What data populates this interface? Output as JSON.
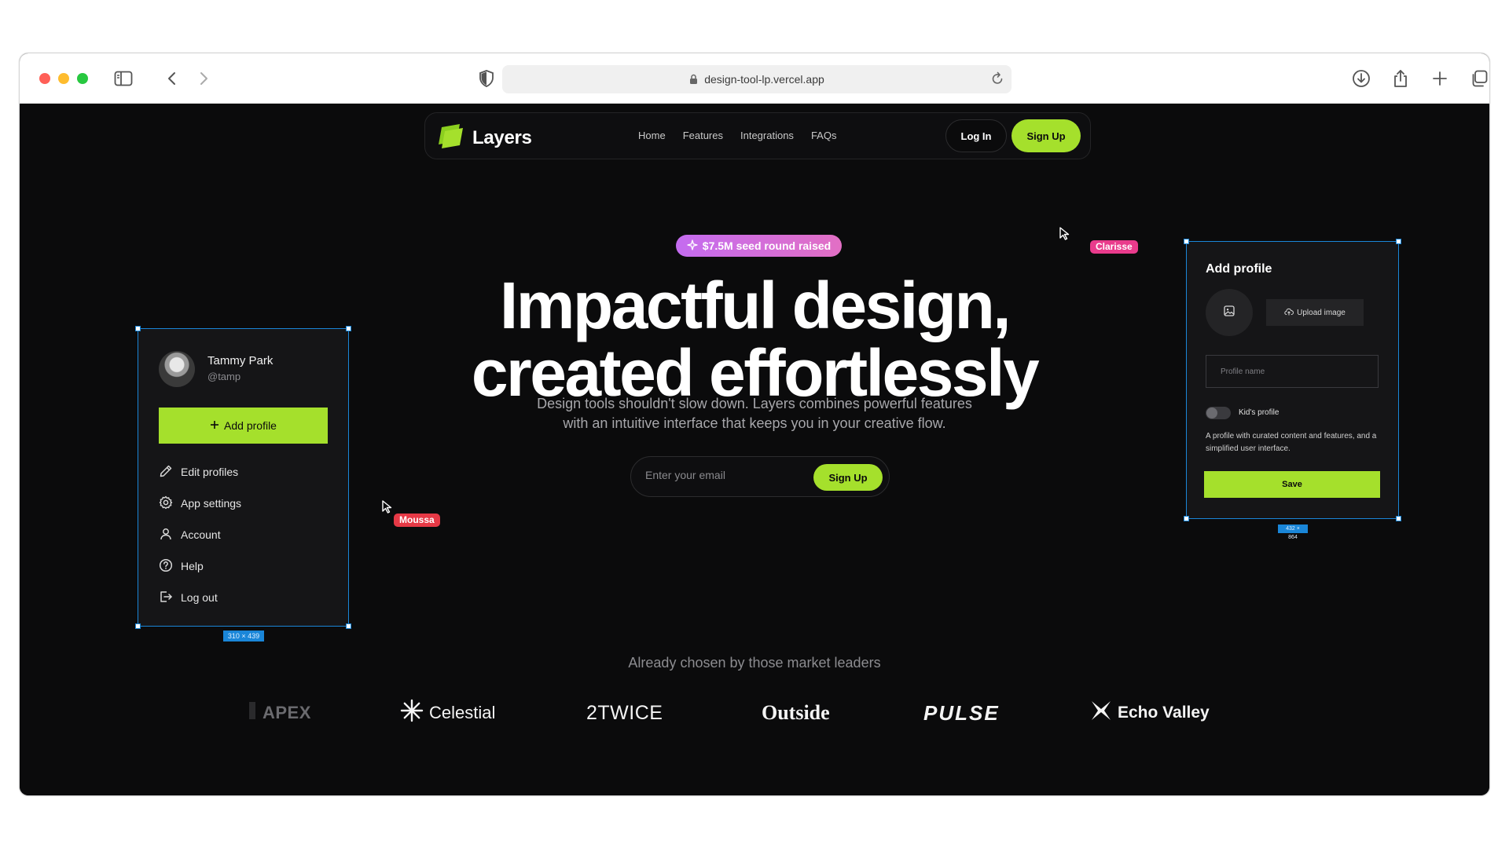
{
  "browser": {
    "url": "design-tool-lp.vercel.app"
  },
  "nav": {
    "logo_text": "Layers",
    "links": [
      "Home",
      "Features",
      "Integrations",
      "FAQs"
    ],
    "login_label": "Log In",
    "signup_label": "Sign Up"
  },
  "hero": {
    "badge": "$7.5M seed round raised",
    "headline_line1": "Impactful design,",
    "headline_line2": "created effortlessly",
    "subtitle_line1": "Design tools shouldn't slow down. Layers combines powerful features",
    "subtitle_line2": "with an intuitive interface that keeps you in your creative flow.",
    "email_placeholder": "Enter your email",
    "signup_label": "Sign Up"
  },
  "profile_menu_card": {
    "user_name": "Tammy Park",
    "user_handle": "@tamp",
    "add_profile_label": "Add profile",
    "menu_items": [
      {
        "label": "Edit profiles",
        "icon": "pencil-icon"
      },
      {
        "label": "App settings",
        "icon": "gear-icon"
      },
      {
        "label": "Account",
        "icon": "user-icon"
      },
      {
        "label": "Help",
        "icon": "help-circle-icon"
      },
      {
        "label": "Log out",
        "icon": "logout-icon"
      }
    ],
    "dimension_label": "310 × 439"
  },
  "add_profile_card": {
    "title": "Add profile",
    "upload_label": "Upload image",
    "name_placeholder": "Profile name",
    "toggle_label": "Kid's profile",
    "toggle_on": false,
    "description": "A profile with curated content and features, and a simplified user interface.",
    "save_label": "Save",
    "dimension_label": "432 × 864"
  },
  "cursors": [
    {
      "name": "Clarisse",
      "color": "#e93b8c"
    },
    {
      "name": "Moussa",
      "color": "#e63946"
    }
  ],
  "logos": {
    "heading": "Already chosen by those market leaders",
    "brands": [
      "APEX",
      "Celestial",
      "2TWICE",
      "Outside",
      "PULSE",
      "Echo Valley"
    ]
  },
  "colors": {
    "accent": "#a5e02c",
    "background": "#0b0b0c",
    "selection": "#1a86d8"
  }
}
